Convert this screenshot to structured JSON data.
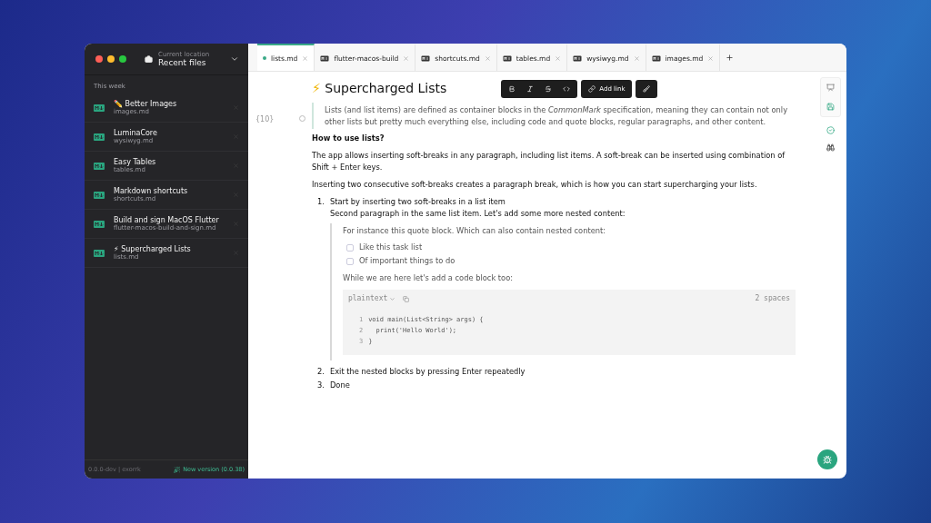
{
  "sidebar": {
    "location_label": "Current location",
    "location": "Recent files",
    "section": "This week",
    "files": [
      {
        "title": "✏️ Better Images",
        "filename": "images.md"
      },
      {
        "title": "LuminaCore",
        "filename": "wysiwyg.md"
      },
      {
        "title": "Easy Tables",
        "filename": "tables.md"
      },
      {
        "title": "Markdown shortcuts",
        "filename": "shortcuts.md"
      },
      {
        "title": "Build and sign MacOS Flutter",
        "filename": "flutter-macos-build-and-sign.md"
      },
      {
        "title": "⚡ Supercharged Lists",
        "filename": "lists.md"
      }
    ],
    "version": "0.0.0-dev | exorrk",
    "update": "New version (0.0.38)"
  },
  "tabs": [
    {
      "label": "lists.md",
      "selected": true,
      "kind": "modified"
    },
    {
      "label": "flutter-macos-build",
      "selected": false,
      "kind": "file"
    },
    {
      "label": "shortcuts.md",
      "selected": false,
      "kind": "file"
    },
    {
      "label": "tables.md",
      "selected": false,
      "kind": "file"
    },
    {
      "label": "wysiwyg.md",
      "selected": false,
      "kind": "file"
    },
    {
      "label": "images.md",
      "selected": false,
      "kind": "file"
    }
  ],
  "format_toolbar": {
    "add_link": "Add link"
  },
  "document": {
    "title_icon": "⚡",
    "title": "Supercharged Lists",
    "gutter": "{10}",
    "blocks": [
      {
        "kind": "quote",
        "text": "Lists (and list items) are defined as container blocks in the *CommonMark* specification, meaning they can contain not only other lists but pretty much everything else, including code and quote blocks, regular paragraphs, and other content."
      },
      {
        "kind": "heading",
        "text": "How to use lists?"
      },
      {
        "kind": "paragraph",
        "text": "The app allows inserting soft-breaks in any paragraph, including list items. A soft-break can be inserted using combination of Shift + Enter keys."
      },
      {
        "kind": "paragraph",
        "text": "Inserting two consecutive soft-breaks creates a paragraph break, which is how you can start supercharging your lists."
      },
      {
        "kind": "list",
        "items": [
          {
            "number": "1.",
            "lines": [
              "Start by inserting two soft-breaks in a list item",
              "Second paragraph in the same list item. Let's add some more nested content:"
            ],
            "quote": {
              "text": "For instance this quote block. Which can also contain nested content:",
              "tasks": [
                {
                  "text": "Like this task list",
                  "checked": false
                },
                {
                  "text": "Of important things to do",
                  "checked": false
                }
              ],
              "after": "While we are here let's add a code block too:",
              "code": {
                "language": "plaintext",
                "indent": "2 spaces",
                "lines": [
                  {
                    "number": "1",
                    "text": "void main(List<String> args) {"
                  },
                  {
                    "number": "2",
                    "text": "  print('Hello World');"
                  },
                  {
                    "number": "3",
                    "text": "}"
                  }
                ]
              }
            }
          },
          {
            "number": "2.",
            "lines": [
              "Exit the nested blocks by pressing Enter repeatedly"
            ]
          },
          {
            "number": "3.",
            "lines": [
              "Done"
            ]
          }
        ]
      }
    ]
  }
}
